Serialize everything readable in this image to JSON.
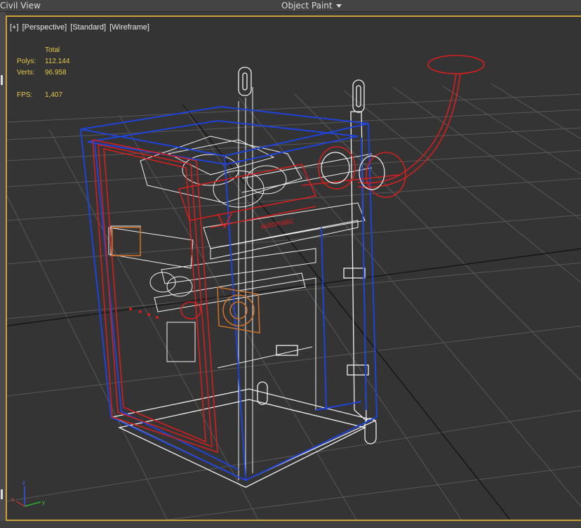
{
  "topbar": {
    "left_label": "Civil View",
    "right_label": "Object Paint"
  },
  "viewport": {
    "labels": [
      "[+]",
      "[Perspective]",
      "[Standard]",
      "[Wireframe]"
    ],
    "stats": {
      "header": "Total",
      "polys_label": "Polys:",
      "polys_value": "112.144",
      "verts_label": "Verts:",
      "verts_value": "96.958",
      "fps_label": "FPS:",
      "fps_value": "1,407"
    },
    "model_text": "automatic",
    "gizmo": {
      "x": "x",
      "y": "y",
      "z": "z"
    }
  },
  "colors": {
    "active_border": "#c9a33a",
    "stats_text": "#e7c84a",
    "wire_blue": "#1f43d8",
    "wire_red": "#d31f1f",
    "wire_white": "#f2f2f2",
    "grid": "#555555"
  }
}
